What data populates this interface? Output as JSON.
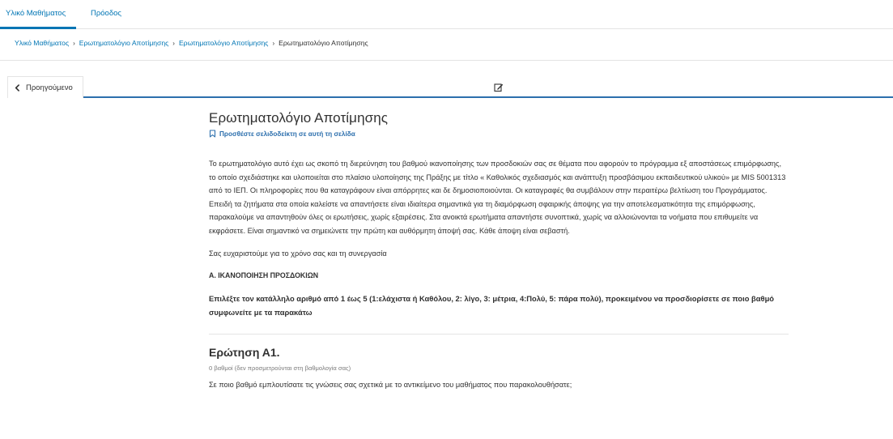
{
  "topnav": {
    "tabs": [
      {
        "label": "Υλικό Μαθήματος",
        "active": true
      },
      {
        "label": "Πρόοδος",
        "active": false
      }
    ]
  },
  "breadcrumb": {
    "items": [
      "Υλικό Μαθήματος",
      "Ερωτηματολόγιο Αποτίμησης",
      "Ερωτηματολόγιο Αποτίμησης"
    ],
    "separator": "›",
    "current": "Ερωτηματολόγιο Αποτίμησης"
  },
  "sequence_nav": {
    "previous_label": "Προηγούμενο",
    "previous_icon": "chevron-left-icon",
    "unit_icon": "edit-icon"
  },
  "unit": {
    "title": "Ερωτηματολόγιο Αποτίμησης",
    "bookmark_label": "Προσθέστε σελιδοδείκτη σε αυτή τη σελίδα",
    "bookmark_icon": "bookmark-icon",
    "intro": "Το ερωτηματολόγιο αυτό έχει ως σκοπό τη διερεύνηση του βαθμού ικανοποίησης των προσδοκιών σας σε θέματα που αφορούν το πρόγραμμα εξ αποστάσεως επιμόρφωσης, το οποίο σχεδιάστηκε και υλοποιείται στο πλαίσιο υλοποίησης της Πράξης με τίτλο « Καθολικός σχεδιασμός και ανάπτυξη προσβάσιμου εκπαιδευτικού υλικού» με MIS 5001313 από το ΙΕΠ. Οι πληροφορίες που θα καταγράφουν είναι απόρρητες και δε δημοσιοποιούνται. Οι καταγραφές θα συμβάλουν στην περαιτέρω βελτίωση του Προγράμματος. Επειδή τα ζητήματα στα οποία καλείστε να απαντήσετε είναι ιδιαίτερα σημαντικά για τη διαμόρφωση σφαιρικής άποψης για την αποτελεσματικότητα της επιμόρφωσης, παρακαλούμε να απαντηθούν όλες οι ερωτήσεις, χωρίς εξαιρέσεις. Στα ανοικτά ερωτήματα απαντήστε συνοπτικά, χωρίς να αλλοιώνονται τα νοήματα που επιθυμείτε να εκφράσετε. Είναι σημαντικό να σημειώνετε την πρώτη και αυθόρμητη άποψή σας. Κάθε άποψη είναι σεβαστή.",
    "thanks": "Σας ευχαριστούμε για το χρόνο σας και τη συνεργασία",
    "section_heading": "Α. ΙΚΑΝΟΠΟΙΗΣΗ ΠΡΟΣΔΟΚΙΩΝ",
    "instructions": "Επιλέξτε τον κατάλληλο αριθμό από 1 έως 5 (1:ελάχιστα ή Καθόλου, 2: λίγο, 3: μέτρια, 4:Πολύ, 5: πάρα πολύ), προκειμένου να προσδιορίσετε σε ποιο βαθμό συμφωνείτε με τα παρακάτω"
  },
  "question": {
    "title": "Ερώτηση Α1.",
    "points": "0 βαθμοί (δεν προσμετρούνται στη βαθμολογία σας)",
    "text": "Σε ποιο βαθμό εμπλουτίσατε τις γνώσεις σας σχετικά με το αντικείμενο του μαθήματος που παρακολουθήσατε;"
  },
  "colors": {
    "link": "#0075b4",
    "accent_border": "#2c6fad",
    "text": "#313131",
    "muted": "#7a7a7a",
    "divider": "#e4e4e4"
  }
}
